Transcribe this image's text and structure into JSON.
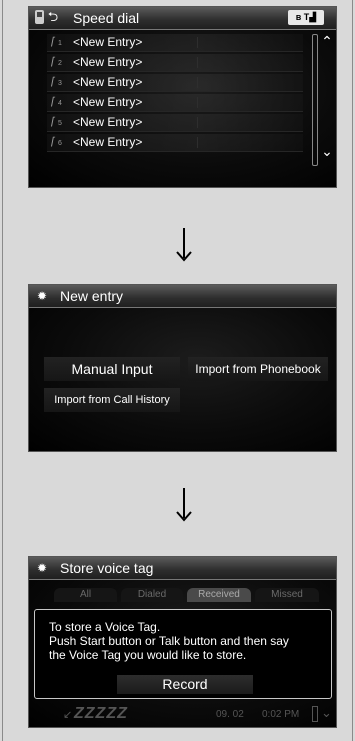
{
  "speed_dial": {
    "title": "Speed dial",
    "status": "⊛Ťı",
    "entries": [
      {
        "num": "1",
        "label": "<New Entry>"
      },
      {
        "num": "2",
        "label": "<New Entry>"
      },
      {
        "num": "3",
        "label": "<New Entry>"
      },
      {
        "num": "4",
        "label": "<New Entry>"
      },
      {
        "num": "5",
        "label": "<New Entry>"
      },
      {
        "num": "6",
        "label": "<New Entry>"
      }
    ],
    "scroll_up": "˄",
    "scroll_down": "˅"
  },
  "new_entry": {
    "title": "New entry",
    "manual_input": "Manual Input",
    "import_phonebook": "Import from Phonebook",
    "import_call_history": "Import from Call History"
  },
  "store_voice_tag": {
    "title": "Store voice tag",
    "tabs": [
      "All",
      "Dialed",
      "Received",
      "Missed"
    ],
    "active_tab": "Received",
    "message_lines": [
      "To store a Voice Tag.",
      "Push Start button or Talk button and then say",
      "the Voice Tag you would like to store."
    ],
    "record_label": "Record",
    "footer": {
      "name": "ZZZZZ",
      "date": "09. 02",
      "time": "0:02 PM"
    }
  },
  "icons": {
    "gear": "✵",
    "back": "⮌",
    "handset": "⌐"
  }
}
